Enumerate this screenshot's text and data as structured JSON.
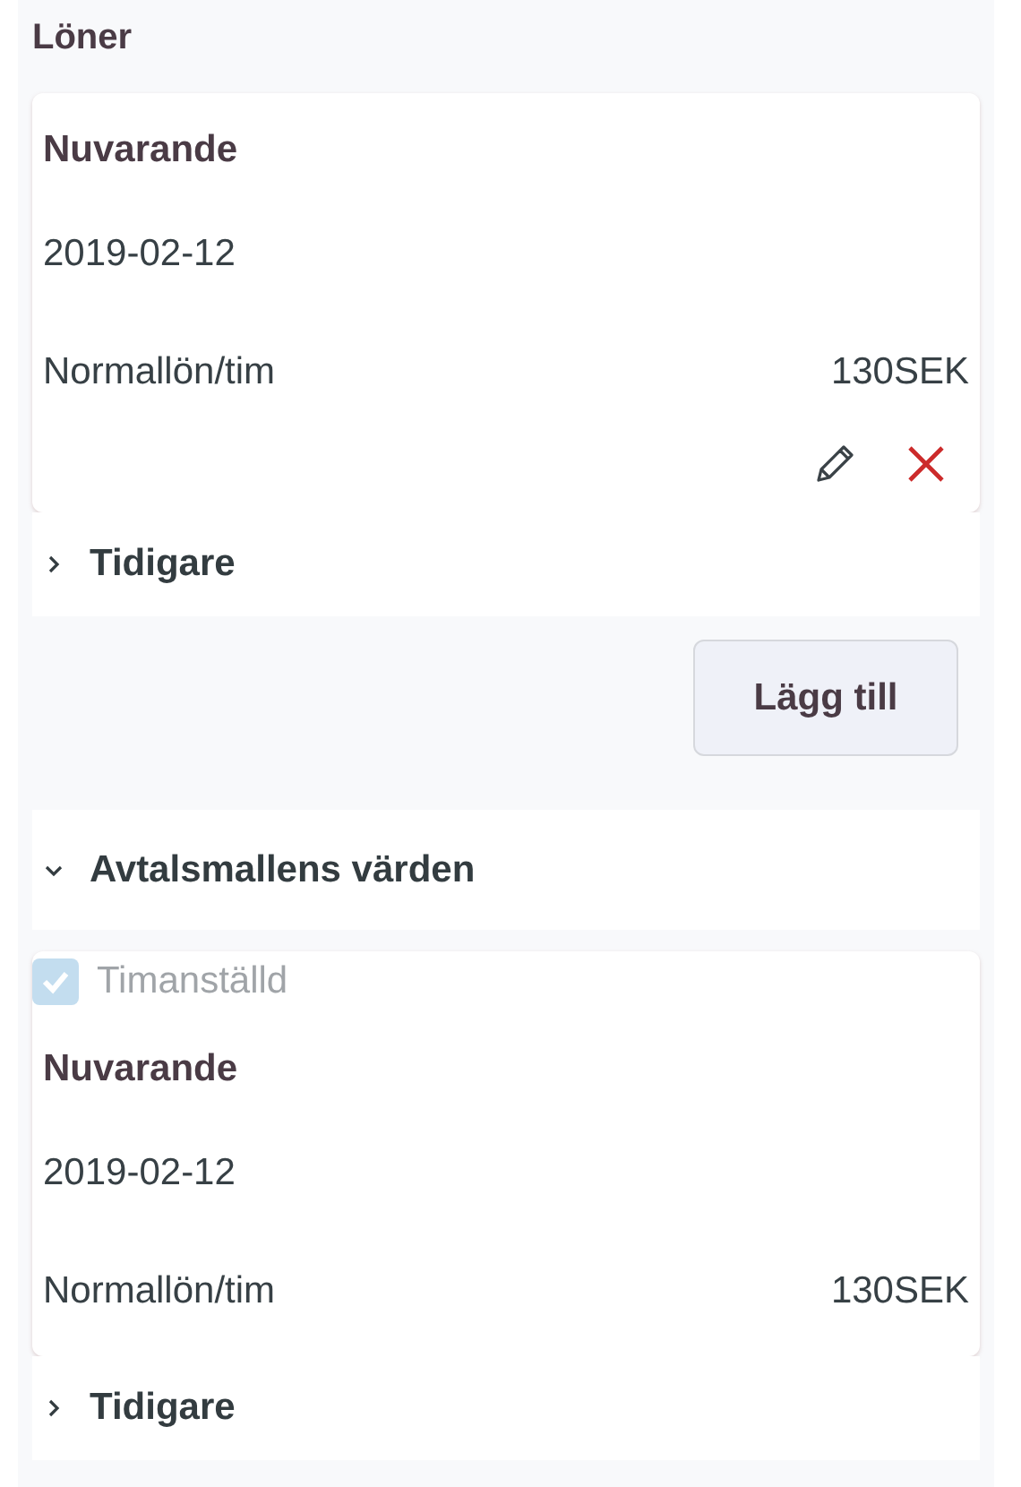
{
  "title": "Löner",
  "salary": {
    "heading": "Nuvarande",
    "date": "2019-02-12",
    "rows": [
      {
        "label": "Normallön/tim",
        "value": "130SEK"
      }
    ],
    "actions": [
      {
        "kind": "edit"
      },
      {
        "kind": "delete"
      }
    ]
  },
  "history": {
    "label": "Tidigare",
    "expanded": false
  },
  "add_button": "Lägg till",
  "template": {
    "label": "Avtalsmallens värden",
    "expanded": true,
    "checkbox": {
      "label": "Timanställd",
      "checked": true,
      "disabled": true
    },
    "salary": {
      "heading": "Nuvarande",
      "date": "2019-02-12",
      "rows": [
        {
          "label": "Normallön/tim",
          "value": "130SEK"
        }
      ]
    },
    "history": {
      "label": "Tidigare",
      "expanded": false
    }
  }
}
